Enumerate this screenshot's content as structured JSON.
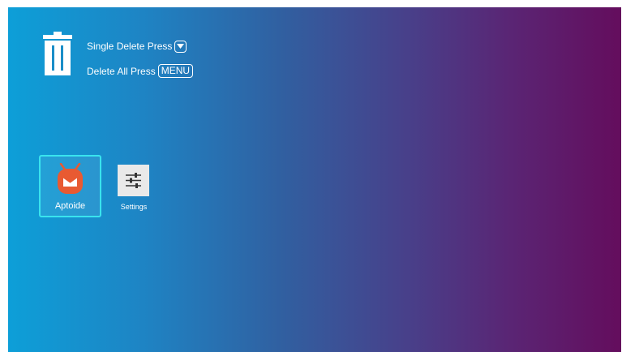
{
  "hints": {
    "single_delete": "Single Delete Press",
    "delete_all": "Delete All Press",
    "menu_key": "MENU"
  },
  "apps": [
    {
      "label": "Aptoide",
      "icon": "aptoide-icon",
      "selected": true
    },
    {
      "label": "Settings",
      "icon": "settings-sliders-icon",
      "selected": false
    }
  ],
  "colors": {
    "gradient_start": "#0d9fd8",
    "gradient_end": "#640d5d",
    "selection_border": "#39e4ee",
    "aptoide_orange": "#e85a32"
  }
}
